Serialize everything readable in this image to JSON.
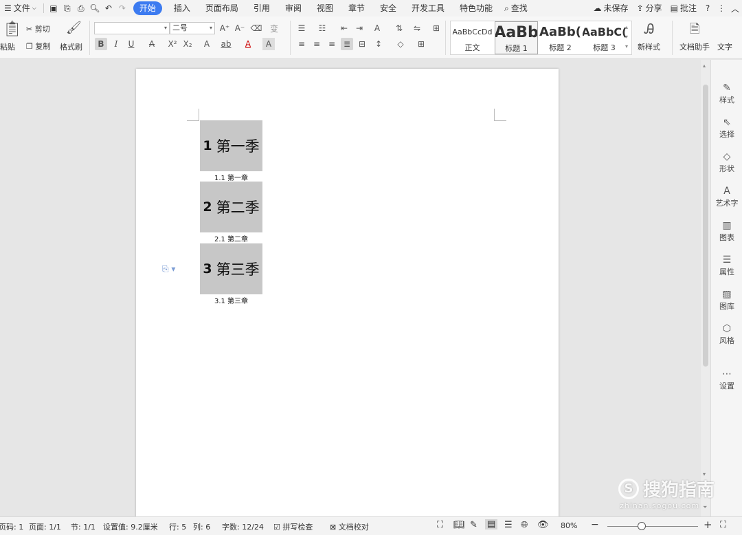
{
  "menubar": {
    "file": "文件",
    "tabs": [
      "开始",
      "插入",
      "页面布局",
      "引用",
      "审阅",
      "视图",
      "章节",
      "安全",
      "开发工具",
      "特色功能"
    ],
    "active_tab": "开始",
    "search": "查找",
    "unsaved": "未保存",
    "share": "分享",
    "comment": "批注"
  },
  "ribbon": {
    "paste": "粘贴",
    "cut": "剪切",
    "copy": "复制",
    "format_painter": "格式刷",
    "font_name": "",
    "font_size": "二号",
    "styles": [
      {
        "preview": "AaBbCcDd",
        "name": "正文"
      },
      {
        "preview": "AaBb",
        "name": "标题 1"
      },
      {
        "preview": "AaBb(",
        "name": "标题 2"
      },
      {
        "preview": "AaBbC(",
        "name": "标题 3"
      }
    ],
    "new_style": "新样式",
    "doc_assistant": "文档助手",
    "text_tool": "文字"
  },
  "document": {
    "headings": [
      {
        "num": "1",
        "text": "第一季",
        "sub": "1.1 第一章"
      },
      {
        "num": "2",
        "text": "第二季",
        "sub": "2.1 第二章"
      },
      {
        "num": "3",
        "text": "第三季",
        "sub": "3.1 第三章"
      }
    ]
  },
  "taskpane": [
    "样式",
    "选择",
    "形状",
    "艺术字",
    "图表",
    "属性",
    "图库",
    "风格",
    "设置"
  ],
  "statusbar": {
    "page_code": "页码: 1",
    "page": "页面: 1/1",
    "section": "节: 1/1",
    "setting": "设置值: 9.2厘米",
    "row": "行: 5",
    "col": "列: 6",
    "word_count": "字数: 12/24",
    "spell_check": "拼写检查",
    "doc_proof": "文档校对",
    "zoom": "80%"
  },
  "watermark": {
    "text": "搜狗指南",
    "url": "zhinan.sogou.com"
  },
  "colors": {
    "accent": "#3c7bf0",
    "heading_bg": "#c7c7c7"
  }
}
